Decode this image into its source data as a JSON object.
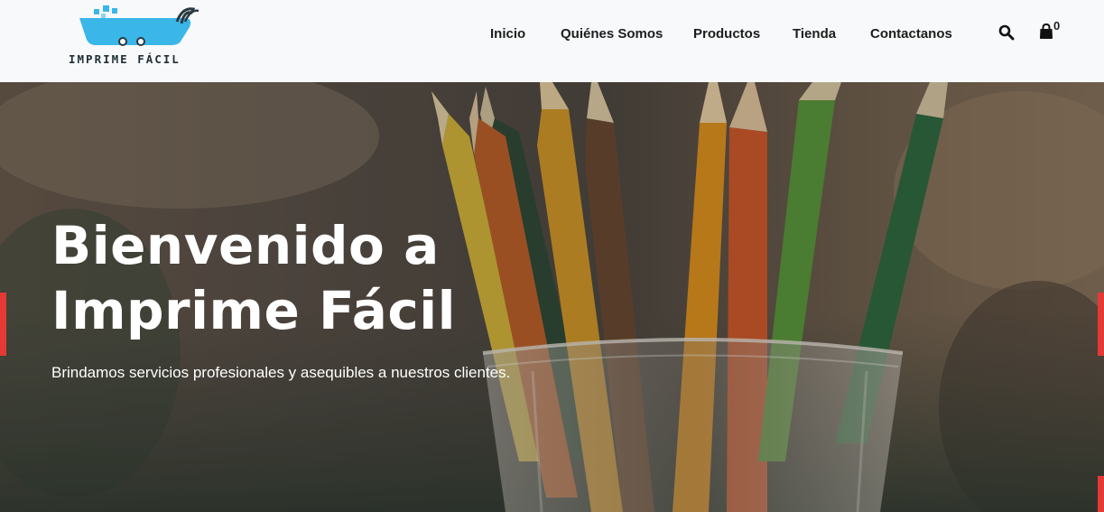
{
  "brand": {
    "logo_text": "IMPRIME FÁCIL",
    "logo_color": "#3bb6e8"
  },
  "nav": {
    "items": [
      {
        "label": "Inicio"
      },
      {
        "label": "Quiénes Somos"
      },
      {
        "label": "Productos"
      },
      {
        "label": "Tienda"
      },
      {
        "label": "Contactanos"
      }
    ],
    "search_icon": "search-icon",
    "cart_icon": "shopping-bag-icon",
    "cart_count": "0"
  },
  "hero": {
    "title_line1": "Bienvenido a",
    "title_line2": "Imprime Fácil",
    "subtitle": "Brindamos servicios profesionales y asequibles a nuestros clientes.",
    "background": "colored-pencils-in-glass",
    "accent_color": "#e53935"
  }
}
